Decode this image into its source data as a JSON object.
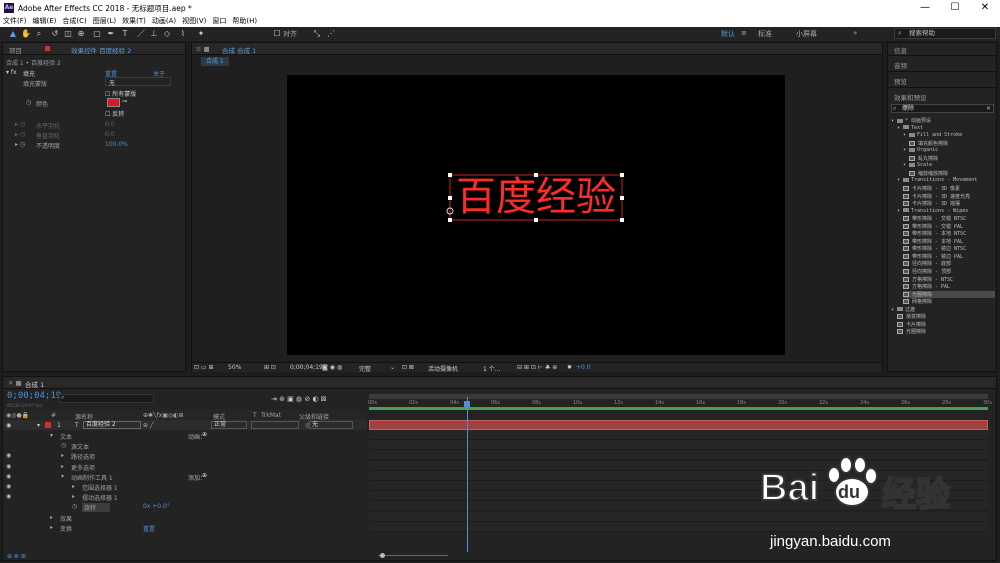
{
  "window": {
    "title": "Adobe After Effects CC 2018 - 无标题项目.aep *",
    "app_icon": "Ae",
    "minimize": "—",
    "maximize": "☐",
    "close": "✕"
  },
  "menu": [
    "文件(F)",
    "编辑(E)",
    "合成(C)",
    "图层(L)",
    "效果(T)",
    "动画(A)",
    "视图(V)",
    "窗口",
    "帮助(H)"
  ],
  "toolbar": {
    "align_label": "对齐"
  },
  "workspaces": {
    "default": "默认",
    "separator": "≡",
    "standard": "标准",
    "small_screen": "小屏幕",
    "more": "»"
  },
  "search": {
    "placeholder": "搜索帮助"
  },
  "left_panel": {
    "tab_project": "项目",
    "tab_effect_controls": "效果控件 百度经验 2",
    "breadcrumb": "合成 1 • 百度经验 2",
    "effect_name": "填充",
    "reset": "重置",
    "about": "关于",
    "rows": [
      {
        "label": "填充蒙版",
        "value": "无"
      },
      {
        "label": "",
        "value": "所有蒙版"
      },
      {
        "label": "颜色",
        "value": ""
      },
      {
        "label": "",
        "value": "反转"
      },
      {
        "label": "水平羽化",
        "value": "0.0"
      },
      {
        "label": "垂直羽化",
        "value": "0.0"
      },
      {
        "label": "不透明度",
        "value": "100.0%"
      }
    ],
    "fill_color": "#e0141e"
  },
  "comp_panel": {
    "tab": "合成 合成 1",
    "subtab": "合成 1",
    "text": "百度经验",
    "text_color": "#ff2a2a",
    "zoom": "50%",
    "timecode": "0;00;04;19",
    "quality": "完整",
    "camera": "活动摄像机",
    "views": "1 个...",
    "offset": "+0.0"
  },
  "right_panel": {
    "info": "信息",
    "audio": "音频",
    "preview": "预览",
    "effects_presets": "效果和预设",
    "search_value": "擦除",
    "tree": [
      {
        "indent": 0,
        "kind": "folder",
        "label": "* 动画预设"
      },
      {
        "indent": 1,
        "kind": "folder",
        "label": "Text"
      },
      {
        "indent": 2,
        "kind": "folder",
        "label": "Fill and Stroke"
      },
      {
        "indent": 3,
        "kind": "fx",
        "label": "填充颜色擦除"
      },
      {
        "indent": 2,
        "kind": "folder",
        "label": "Organic"
      },
      {
        "indent": 3,
        "kind": "fx",
        "label": "乱丸擦除"
      },
      {
        "indent": 2,
        "kind": "folder",
        "label": "Scale"
      },
      {
        "indent": 3,
        "kind": "fx",
        "label": "缩放缩放擦除"
      },
      {
        "indent": 1,
        "kind": "folder",
        "label": "Transitions - Movement"
      },
      {
        "indent": 2,
        "kind": "fx",
        "label": "卡片擦除 - 3D 像素"
      },
      {
        "indent": 2,
        "kind": "fx",
        "label": "卡片擦除 - 3D 速度光亮"
      },
      {
        "indent": 2,
        "kind": "fx",
        "label": "卡片擦除 - 3D 摇摆"
      },
      {
        "indent": 1,
        "kind": "folder",
        "label": "Transitions - Wipes"
      },
      {
        "indent": 2,
        "kind": "fx",
        "label": "带形擦除 - 交错 NTSC"
      },
      {
        "indent": 2,
        "kind": "fx",
        "label": "带形擦除 - 交错 PAL"
      },
      {
        "indent": 2,
        "kind": "fx",
        "label": "带形擦除 - 本地 NTSC"
      },
      {
        "indent": 2,
        "kind": "fx",
        "label": "带形擦除 - 本地 PAL"
      },
      {
        "indent": 2,
        "kind": "fx",
        "label": "带形擦除 - 镜边 NTSC"
      },
      {
        "indent": 2,
        "kind": "fx",
        "label": "带形擦除 - 镜边 PAL"
      },
      {
        "indent": 2,
        "kind": "fx",
        "label": "径向擦除 - 底部"
      },
      {
        "indent": 2,
        "kind": "fx",
        "label": "径向擦除 - 顶部"
      },
      {
        "indent": 2,
        "kind": "fx",
        "label": "方格擦除 - NTSC"
      },
      {
        "indent": 2,
        "kind": "fx",
        "label": "方格擦除 - PAL"
      },
      {
        "indent": 2,
        "kind": "fx",
        "label": "光圈擦除",
        "selected": true
      },
      {
        "indent": 2,
        "kind": "fx",
        "label": "网格擦除"
      },
      {
        "indent": 0,
        "kind": "folder",
        "label": "过渡"
      },
      {
        "indent": 1,
        "kind": "fx",
        "label": "渐变擦除"
      },
      {
        "indent": 1,
        "kind": "fx",
        "label": "卡片擦除"
      },
      {
        "indent": 1,
        "kind": "fx",
        "label": "光圈擦除"
      }
    ]
  },
  "timeline": {
    "tab": "合成 1",
    "timecode": "0;00;04;19",
    "timecode_sub": "00139 (29.97 fps)",
    "headers": {
      "num": "#",
      "name": "源名称",
      "mode": "模式",
      "t": "T",
      "trkmat": "TrkMat",
      "parent": "父级和链接"
    },
    "layer": {
      "num": "1",
      "type": "T",
      "name": "百度经验 2",
      "mode": "正常",
      "parent": "无",
      "color": "#c93030"
    },
    "props": [
      {
        "indent": 1,
        "label": "文本",
        "right": "动画："
      },
      {
        "indent": 2,
        "label": "源文本",
        "right": ""
      },
      {
        "indent": 2,
        "label": "路径选项",
        "right": ""
      },
      {
        "indent": 2,
        "label": "更多选项",
        "right": ""
      },
      {
        "indent": 2,
        "label": "动画制作工具 1",
        "right": "添加："
      },
      {
        "indent": 3,
        "label": "范围选择器 1",
        "right": ""
      },
      {
        "indent": 3,
        "label": "摆动选择器 1",
        "right": ""
      },
      {
        "indent": 3,
        "label": "旋转",
        "right": "0x +0.0°"
      },
      {
        "indent": 1,
        "label": "效果",
        "right": ""
      },
      {
        "indent": 1,
        "label": "变换",
        "right": "重置"
      }
    ],
    "ruler": [
      "00s",
      "02s",
      "04s",
      "06s",
      "08s",
      "10s",
      "12s",
      "14s",
      "16s",
      "18s",
      "20s",
      "22s",
      "24s",
      "26s",
      "28s",
      "30s"
    ],
    "playhead_seconds": 4.633,
    "duration_seconds": 30
  },
  "watermark": {
    "brand_latin": "Bai",
    "brand_du": "du",
    "brand_cn": "经验",
    "url": "jingyan.baidu.com"
  },
  "colors": {
    "accent": "#4f8fd8",
    "panel": "#232323",
    "bar": "#a04040"
  }
}
